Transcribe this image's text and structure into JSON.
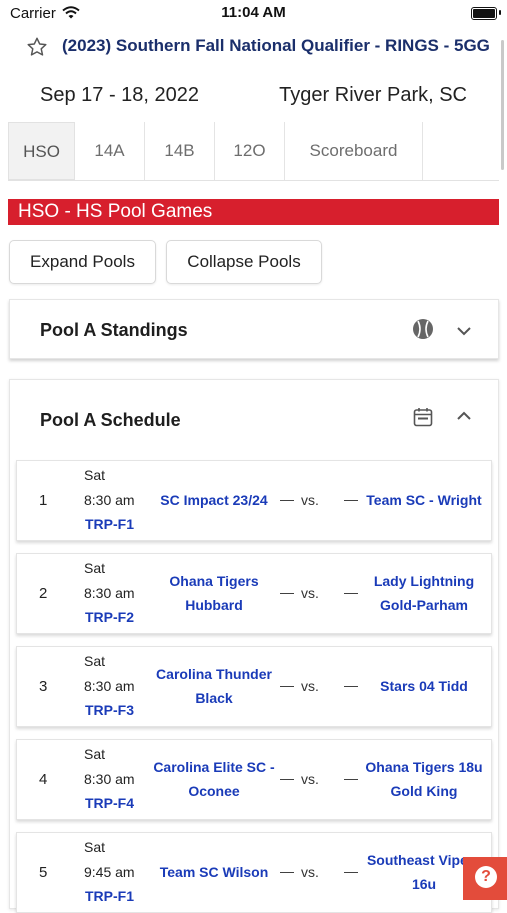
{
  "status_bar": {
    "carrier": "Carrier",
    "time": "11:04 AM"
  },
  "event": {
    "title": "(2023) Southern Fall National Qualifier - RINGS - 5GG",
    "dates": "Sep 17 - 18, 2022",
    "location": "Tyger River Park, SC"
  },
  "tabs": [
    {
      "label": "HSO",
      "active": true
    },
    {
      "label": "14A"
    },
    {
      "label": "14B"
    },
    {
      "label": "12O"
    },
    {
      "label": "Scoreboard"
    }
  ],
  "banner": "HSO - HS Pool Games",
  "buttons": {
    "expand": "Expand Pools",
    "collapse": "Collapse Pools"
  },
  "standings": {
    "title": "Pool A Standings",
    "icon": "softball-icon"
  },
  "schedule": {
    "title": "Pool A Schedule",
    "icon": "calendar-icon",
    "games": [
      {
        "num": "1",
        "day": "Sat",
        "time": "8:30 am",
        "field": "TRP-F1",
        "home": "SC Impact 23/24",
        "vs": "vs.",
        "away": "Team SC - Wright"
      },
      {
        "num": "2",
        "day": "Sat",
        "time": "8:30 am",
        "field": "TRP-F2",
        "home": "Ohana Tigers Hubbard",
        "vs": "vs.",
        "away": "Lady Lightning Gold-Parham"
      },
      {
        "num": "3",
        "day": "Sat",
        "time": "8:30 am",
        "field": "TRP-F3",
        "home": "Carolina Thunder Black",
        "vs": "vs.",
        "away": "Stars 04 Tidd"
      },
      {
        "num": "4",
        "day": "Sat",
        "time": "8:30 am",
        "field": "TRP-F4",
        "home": "Carolina Elite SC - Oconee",
        "vs": "vs.",
        "away": "Ohana Tigers 18u Gold King"
      },
      {
        "num": "5",
        "day": "Sat",
        "time": "9:45 am",
        "field": "TRP-F1",
        "home": "Team SC Wilson",
        "vs": "vs.",
        "away": "Southeast Vipers 16u"
      }
    ]
  },
  "help": {
    "icon": "help-icon",
    "symbol": "?"
  },
  "colors": {
    "accent": "#d71f2d",
    "link": "#1a3bb8",
    "title": "#1b2f6b",
    "help": "#e34c3b"
  }
}
